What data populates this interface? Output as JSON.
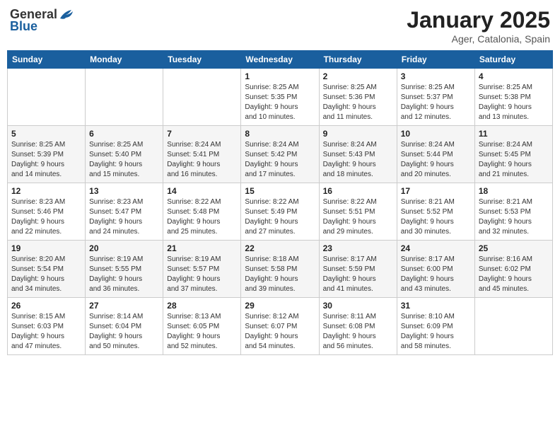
{
  "header": {
    "logo": {
      "general": "General",
      "blue": "Blue"
    },
    "title": "January 2025",
    "location": "Ager, Catalonia, Spain"
  },
  "weekdays": [
    "Sunday",
    "Monday",
    "Tuesday",
    "Wednesday",
    "Thursday",
    "Friday",
    "Saturday"
  ],
  "weeks": [
    [
      {
        "day": "",
        "info": ""
      },
      {
        "day": "",
        "info": ""
      },
      {
        "day": "",
        "info": ""
      },
      {
        "day": "1",
        "info": "Sunrise: 8:25 AM\nSunset: 5:35 PM\nDaylight: 9 hours\nand 10 minutes."
      },
      {
        "day": "2",
        "info": "Sunrise: 8:25 AM\nSunset: 5:36 PM\nDaylight: 9 hours\nand 11 minutes."
      },
      {
        "day": "3",
        "info": "Sunrise: 8:25 AM\nSunset: 5:37 PM\nDaylight: 9 hours\nand 12 minutes."
      },
      {
        "day": "4",
        "info": "Sunrise: 8:25 AM\nSunset: 5:38 PM\nDaylight: 9 hours\nand 13 minutes."
      }
    ],
    [
      {
        "day": "5",
        "info": "Sunrise: 8:25 AM\nSunset: 5:39 PM\nDaylight: 9 hours\nand 14 minutes."
      },
      {
        "day": "6",
        "info": "Sunrise: 8:25 AM\nSunset: 5:40 PM\nDaylight: 9 hours\nand 15 minutes."
      },
      {
        "day": "7",
        "info": "Sunrise: 8:24 AM\nSunset: 5:41 PM\nDaylight: 9 hours\nand 16 minutes."
      },
      {
        "day": "8",
        "info": "Sunrise: 8:24 AM\nSunset: 5:42 PM\nDaylight: 9 hours\nand 17 minutes."
      },
      {
        "day": "9",
        "info": "Sunrise: 8:24 AM\nSunset: 5:43 PM\nDaylight: 9 hours\nand 18 minutes."
      },
      {
        "day": "10",
        "info": "Sunrise: 8:24 AM\nSunset: 5:44 PM\nDaylight: 9 hours\nand 20 minutes."
      },
      {
        "day": "11",
        "info": "Sunrise: 8:24 AM\nSunset: 5:45 PM\nDaylight: 9 hours\nand 21 minutes."
      }
    ],
    [
      {
        "day": "12",
        "info": "Sunrise: 8:23 AM\nSunset: 5:46 PM\nDaylight: 9 hours\nand 22 minutes."
      },
      {
        "day": "13",
        "info": "Sunrise: 8:23 AM\nSunset: 5:47 PM\nDaylight: 9 hours\nand 24 minutes."
      },
      {
        "day": "14",
        "info": "Sunrise: 8:22 AM\nSunset: 5:48 PM\nDaylight: 9 hours\nand 25 minutes."
      },
      {
        "day": "15",
        "info": "Sunrise: 8:22 AM\nSunset: 5:49 PM\nDaylight: 9 hours\nand 27 minutes."
      },
      {
        "day": "16",
        "info": "Sunrise: 8:22 AM\nSunset: 5:51 PM\nDaylight: 9 hours\nand 29 minutes."
      },
      {
        "day": "17",
        "info": "Sunrise: 8:21 AM\nSunset: 5:52 PM\nDaylight: 9 hours\nand 30 minutes."
      },
      {
        "day": "18",
        "info": "Sunrise: 8:21 AM\nSunset: 5:53 PM\nDaylight: 9 hours\nand 32 minutes."
      }
    ],
    [
      {
        "day": "19",
        "info": "Sunrise: 8:20 AM\nSunset: 5:54 PM\nDaylight: 9 hours\nand 34 minutes."
      },
      {
        "day": "20",
        "info": "Sunrise: 8:19 AM\nSunset: 5:55 PM\nDaylight: 9 hours\nand 36 minutes."
      },
      {
        "day": "21",
        "info": "Sunrise: 8:19 AM\nSunset: 5:57 PM\nDaylight: 9 hours\nand 37 minutes."
      },
      {
        "day": "22",
        "info": "Sunrise: 8:18 AM\nSunset: 5:58 PM\nDaylight: 9 hours\nand 39 minutes."
      },
      {
        "day": "23",
        "info": "Sunrise: 8:17 AM\nSunset: 5:59 PM\nDaylight: 9 hours\nand 41 minutes."
      },
      {
        "day": "24",
        "info": "Sunrise: 8:17 AM\nSunset: 6:00 PM\nDaylight: 9 hours\nand 43 minutes."
      },
      {
        "day": "25",
        "info": "Sunrise: 8:16 AM\nSunset: 6:02 PM\nDaylight: 9 hours\nand 45 minutes."
      }
    ],
    [
      {
        "day": "26",
        "info": "Sunrise: 8:15 AM\nSunset: 6:03 PM\nDaylight: 9 hours\nand 47 minutes."
      },
      {
        "day": "27",
        "info": "Sunrise: 8:14 AM\nSunset: 6:04 PM\nDaylight: 9 hours\nand 50 minutes."
      },
      {
        "day": "28",
        "info": "Sunrise: 8:13 AM\nSunset: 6:05 PM\nDaylight: 9 hours\nand 52 minutes."
      },
      {
        "day": "29",
        "info": "Sunrise: 8:12 AM\nSunset: 6:07 PM\nDaylight: 9 hours\nand 54 minutes."
      },
      {
        "day": "30",
        "info": "Sunrise: 8:11 AM\nSunset: 6:08 PM\nDaylight: 9 hours\nand 56 minutes."
      },
      {
        "day": "31",
        "info": "Sunrise: 8:10 AM\nSunset: 6:09 PM\nDaylight: 9 hours\nand 58 minutes."
      },
      {
        "day": "",
        "info": ""
      }
    ]
  ]
}
